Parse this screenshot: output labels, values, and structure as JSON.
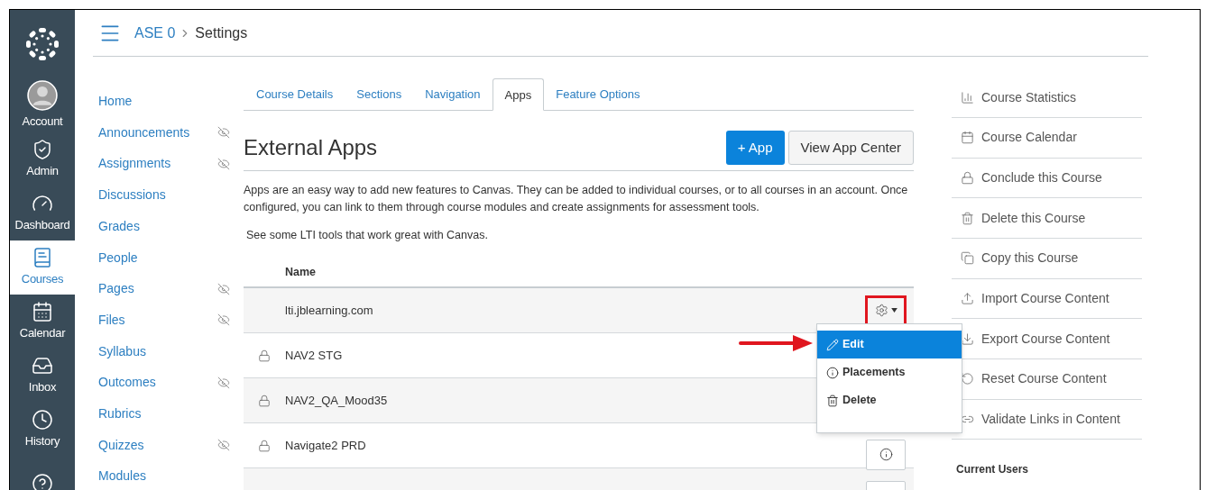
{
  "global_nav": [
    {
      "selected": false
    },
    {
      "label": "Account",
      "selected": false
    },
    {
      "label": "Admin",
      "selected": false
    },
    {
      "label": "Dashboard",
      "selected": false
    },
    {
      "label": "Courses",
      "selected": true
    },
    {
      "label": "Calendar",
      "selected": false
    },
    {
      "label": "Inbox",
      "selected": false
    },
    {
      "label": "History",
      "selected": false
    },
    {
      "selected": false
    }
  ],
  "breadcrumb": {
    "course": "ASE 0",
    "page": "Settings"
  },
  "course_nav": [
    {
      "label": "Home",
      "hidden": false
    },
    {
      "label": "Announcements",
      "hidden": true
    },
    {
      "label": "Assignments",
      "hidden": true
    },
    {
      "label": "Discussions",
      "hidden": false
    },
    {
      "label": "Grades",
      "hidden": false
    },
    {
      "label": "People",
      "hidden": false
    },
    {
      "label": "Pages",
      "hidden": true
    },
    {
      "label": "Files",
      "hidden": true
    },
    {
      "label": "Syllabus",
      "hidden": false
    },
    {
      "label": "Outcomes",
      "hidden": true
    },
    {
      "label": "Rubrics",
      "hidden": false
    },
    {
      "label": "Quizzes",
      "hidden": true
    },
    {
      "label": "Modules",
      "hidden": false
    }
  ],
  "tabs": [
    {
      "label": "Course Details",
      "selected": false
    },
    {
      "label": "Sections",
      "selected": false
    },
    {
      "label": "Navigation",
      "selected": false
    },
    {
      "label": "Apps",
      "selected": true
    },
    {
      "label": "Feature Options",
      "selected": false
    }
  ],
  "heading": "External Apps",
  "buttons": [
    {
      "kind": "primary",
      "label": "+ App"
    },
    {
      "kind": "default",
      "label": "View App Center"
    }
  ],
  "description": "Apps are an easy way to add new features to Canvas. They can be added to individual courses, or to all courses in an account. Once configured, you can link to them through course modules and create assignments for assessment tools.",
  "lti_link": "See some LTI tools that work great with Canvas.",
  "table": {
    "columns": [
      "Name"
    ],
    "rows": [
      {
        "name": "lti.jblearning.com",
        "locked": false,
        "kind": "gear"
      },
      {
        "name": "NAV2 STG",
        "locked": true,
        "kind": "plain"
      },
      {
        "name": "NAV2_QA_Mood35",
        "locked": true,
        "kind": "plain"
      },
      {
        "name": "Navigate2 PRD",
        "locked": true,
        "kind": "info"
      },
      {
        "locked": false,
        "kind": "blank"
      }
    ]
  },
  "menu": {
    "items": [
      {
        "label": "Edit",
        "selected": true
      },
      {
        "label": "Placements",
        "selected": false
      },
      {
        "label": "Delete",
        "selected": false
      }
    ]
  },
  "sidebar": {
    "links": [
      {
        "label": "Course Statistics"
      },
      {
        "label": "Course Calendar"
      },
      {
        "label": "Conclude this Course"
      },
      {
        "label": "Delete this Course"
      },
      {
        "label": "Copy this Course"
      },
      {
        "label": "Import Course Content"
      },
      {
        "label": "Export Course Content"
      },
      {
        "label": "Reset Course Content"
      },
      {
        "label": "Validate Links in Content"
      }
    ],
    "section_title": "Current Users"
  }
}
